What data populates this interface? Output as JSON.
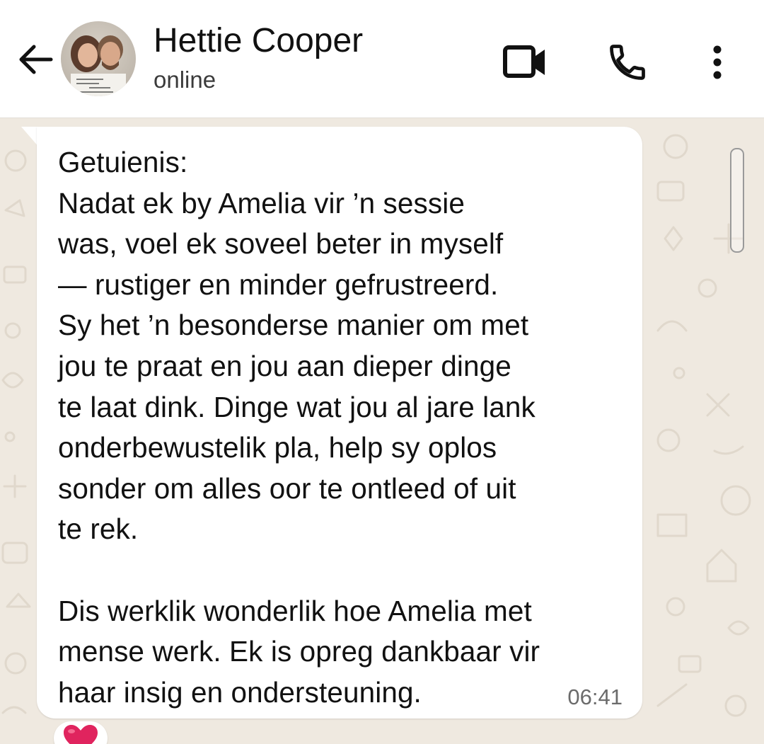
{
  "header": {
    "contact_name": "Hettie Cooper",
    "status": "online",
    "icons": {
      "back": "arrow-back-icon",
      "video": "video-camera-icon",
      "call": "phone-icon",
      "menu": "more-vertical-icon"
    }
  },
  "message": {
    "text": "Getuienis:\nNadat ek by Amelia vir ’n sessie\nwas, voel ek soveel beter in myself\n— rustiger en minder gefrustreerd.\nSy het ’n besonderse manier om met\njou te praat en jou aan dieper dinge\nte laat dink. Dinge wat jou al jare lank\nonderbewustelik pla, help sy oplos\nsonder om alles oor te ontleed of uit\nte rek.\n\nDis werklik wonderlik hoe Amelia met\nmense werk. Ek is opreg dankbaar vir\nhaar insig en ondersteuning.",
    "time": "06:41",
    "reaction": "heart-emoji"
  },
  "colors": {
    "chat_background": "#efe9e0",
    "bubble": "#ffffff",
    "header": "#ffffff",
    "reaction_heart": "#e0245e"
  }
}
